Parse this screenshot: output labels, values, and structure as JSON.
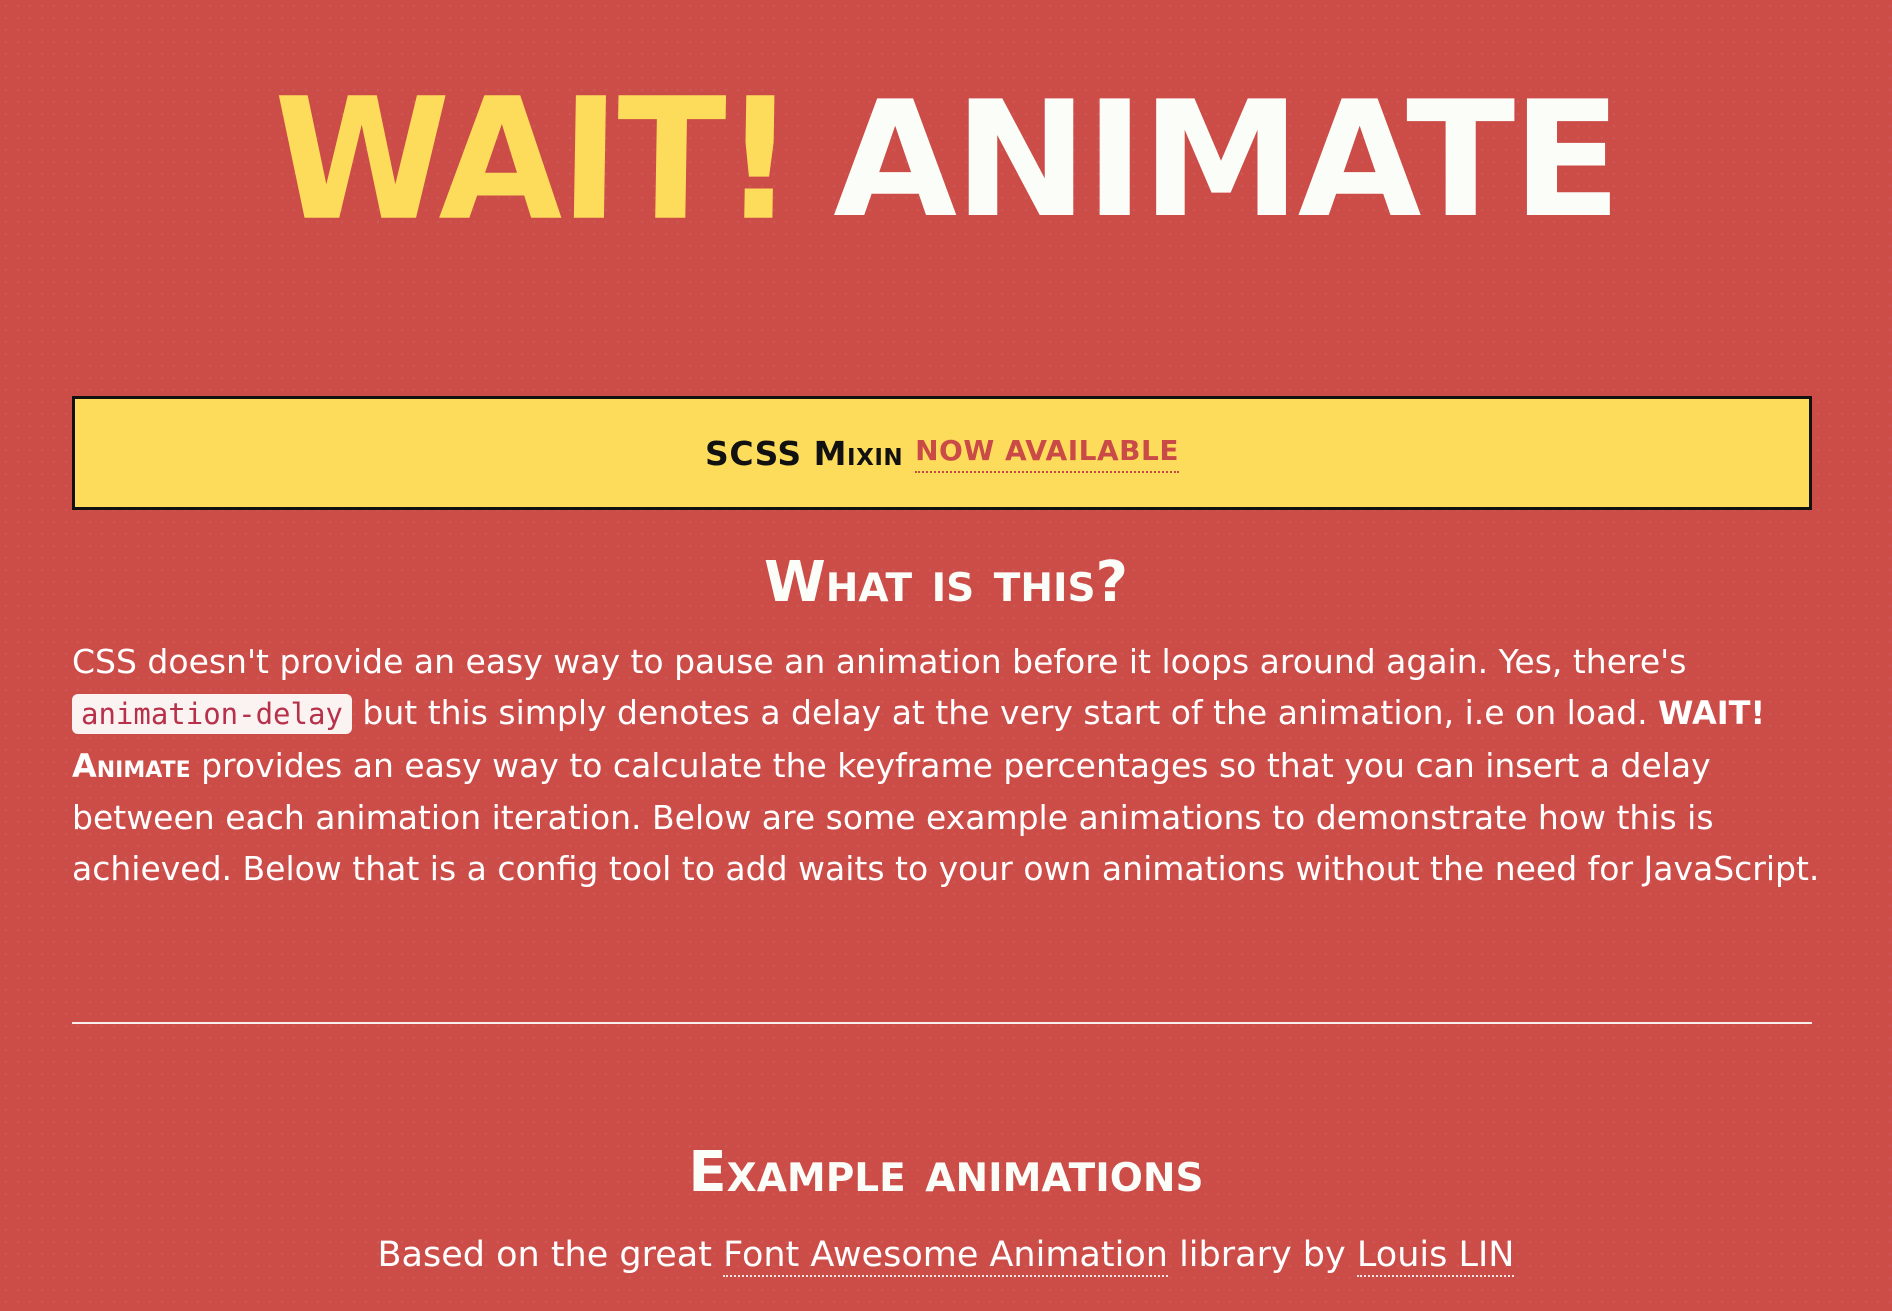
{
  "header": {
    "title_part1": "WAIT!",
    "title_part2": "ANIMATE"
  },
  "banner": {
    "text": "SCSS Mixin",
    "link": "NOW AVAILABLE"
  },
  "about": {
    "heading": "What is this?",
    "p1": "CSS doesn't provide an easy way to pause an animation before it loops around again. Yes, there's",
    "code": "animation-delay",
    "p2": "but this simply denotes a delay at the very start of the animation, i.e on load.",
    "brand": "WAIT! Animate",
    "p3": "provides an easy way to calculate the keyframe percentages so that you can insert a delay between each animation iteration. Below are some example animations to demonstrate how this is achieved. Below that is a config tool to add waits to your own animations without the need for JavaScript."
  },
  "examples": {
    "heading": "Example animations",
    "byline_prefix": "Based on the great",
    "library_link": "Font Awesome Animation",
    "byline_middle": "library by",
    "author_link": "Louis LIN"
  },
  "colors": {
    "background": "#cc4c48",
    "accent_yellow": "#fddc5c",
    "title_white": "#fbfdf8",
    "code_text": "#b8314a"
  }
}
